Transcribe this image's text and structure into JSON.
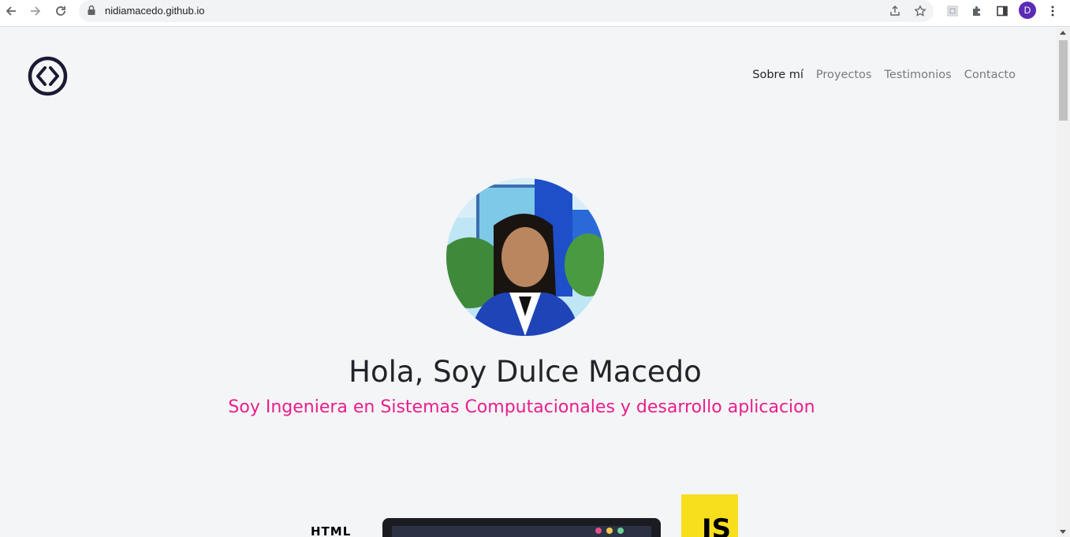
{
  "browser": {
    "url": "nidiamacedo.github.io",
    "avatar_initial": "D",
    "icons": [
      "back-icon",
      "forward-icon",
      "reload-icon",
      "lock-icon",
      "share-icon",
      "star-icon",
      "extension-page-icon",
      "puzzle-icon",
      "side-panel-icon",
      "more-icon"
    ]
  },
  "site": {
    "nav": [
      {
        "label": "Sobre mí",
        "active": true
      },
      {
        "label": "Proyectos",
        "active": false
      },
      {
        "label": "Testimonios",
        "active": false
      },
      {
        "label": "Contacto",
        "active": false
      }
    ],
    "hero": {
      "title": "Hola, Soy Dulce Macedo",
      "subtitle": "Soy Ingeniera en Sistemas Computacionales y desarrollo aplicacion"
    },
    "tech": {
      "html_label": "HTML",
      "js_label": "JS"
    }
  },
  "colors": {
    "accent": "#e91e8c",
    "page_bg": "#f4f5f7",
    "logo": "#1b1a33",
    "js_yellow": "#f7df1e"
  }
}
